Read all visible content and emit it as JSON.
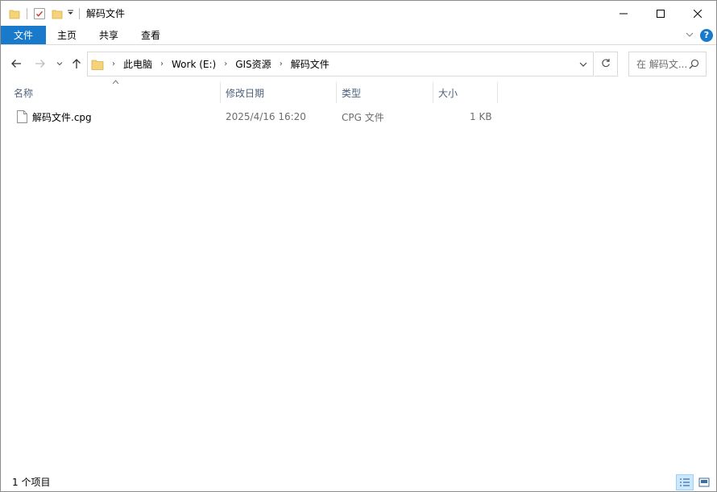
{
  "window": {
    "title": "解码文件",
    "controls": {
      "minimize": "minimize",
      "maximize": "maximize",
      "close": "close"
    }
  },
  "ribbon": {
    "tabs": [
      "文件",
      "主页",
      "共享",
      "查看"
    ],
    "accent": "#1979ca",
    "help": "?"
  },
  "address": {
    "breadcrumbs": [
      "此电脑",
      "Work (E:)",
      "GIS资源",
      "解码文件"
    ],
    "search_placeholder": "在 解码文..."
  },
  "columns": [
    "名称",
    "修改日期",
    "类型",
    "大小"
  ],
  "files": [
    {
      "name": "解码文件.cpg",
      "modified": "2025/4/16 16:20",
      "type": "CPG 文件",
      "size": "1 KB"
    }
  ],
  "status": {
    "item_count": "1 个项目"
  },
  "icons": {
    "folder": "folder-icon",
    "properties": "properties-check-icon",
    "back": "arrow-left-icon",
    "forward": "arrow-right-icon",
    "recent": "chevron-down-icon",
    "up": "arrow-up-icon",
    "refresh": "refresh-icon",
    "search": "search-icon",
    "file": "file-icon",
    "details_view": "details-view-icon",
    "large_icons_view": "large-icons-view-icon"
  }
}
